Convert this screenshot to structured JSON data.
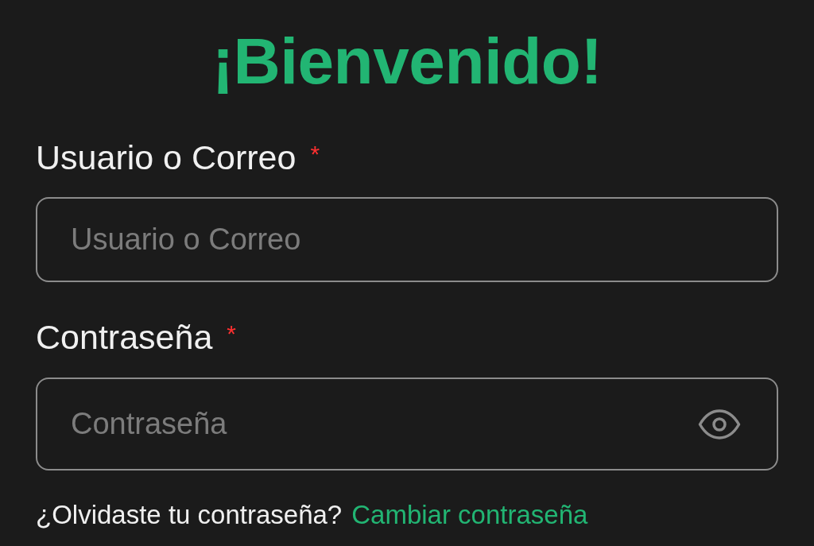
{
  "title": "¡Bienvenido!",
  "fields": [
    {
      "kind": "text",
      "label": "Usuario o Correo",
      "required_mark": "*",
      "placeholder": "Usuario o Correo"
    },
    {
      "kind": "password",
      "label": "Contraseña",
      "required_mark": "*",
      "placeholder": "Contraseña"
    }
  ],
  "forgot": {
    "text": "¿Olvidaste tu contraseña?",
    "link": "Cambiar contraseña"
  }
}
